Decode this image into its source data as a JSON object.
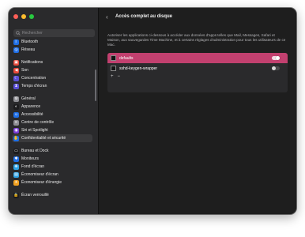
{
  "window": {
    "traffic_colors": [
      "#ff5f57",
      "#febc2e",
      "#28c840"
    ]
  },
  "sidebar": {
    "search_placeholder": "Rechercher",
    "items": [
      {
        "label": "Bluetooth",
        "icon": "bluetooth-icon",
        "color": "#1f6fe6",
        "glyph": "ᛒ"
      },
      {
        "label": "Réseau",
        "icon": "network-icon",
        "color": "#1f6fe6",
        "glyph": "◎"
      },
      {
        "label": "Notifications",
        "icon": "notifications-icon",
        "color": "#e84a3b",
        "glyph": "▣"
      },
      {
        "label": "Son",
        "icon": "sound-icon",
        "color": "#e84a3b",
        "glyph": "◀"
      },
      {
        "label": "Concentration",
        "icon": "focus-icon",
        "color": "#5b4fd6",
        "glyph": "☾"
      },
      {
        "label": "Temps d'écran",
        "icon": "screen-time-icon",
        "color": "#5b4fd6",
        "glyph": "⧗"
      },
      {
        "label": "Général",
        "icon": "general-icon",
        "color": "#8e8e93",
        "glyph": "⚙"
      },
      {
        "label": "Apparence",
        "icon": "appearance-icon",
        "color": "#1c1c1e",
        "glyph": "◐"
      },
      {
        "label": "Accessibilité",
        "icon": "accessibility-icon",
        "color": "#1f6fe6",
        "glyph": "☺"
      },
      {
        "label": "Centre de contrôle",
        "icon": "control-center-icon",
        "color": "#8e8e93",
        "glyph": "≡"
      },
      {
        "label": "Siri et Spotlight",
        "icon": "siri-icon",
        "color": "#7b3fd6",
        "glyph": "◉"
      },
      {
        "label": "Confidentialité et sécurité",
        "icon": "privacy-hand-icon",
        "color": "#1f6fe6",
        "glyph": "✋"
      },
      {
        "label": "Bureau et Dock",
        "icon": "desktop-dock-icon",
        "color": "#1c1c1e",
        "glyph": "▭"
      },
      {
        "label": "Moniteurs",
        "icon": "displays-icon",
        "color": "#1f6fe6",
        "glyph": "✱"
      },
      {
        "label": "Fond d'écran",
        "icon": "wallpaper-icon",
        "color": "#2fa3e6",
        "glyph": "❋"
      },
      {
        "label": "Économiseur d'écran",
        "icon": "screen-saver-icon",
        "color": "#2fa3e6",
        "glyph": "▤"
      },
      {
        "label": "Économiseur d'énergie",
        "icon": "energy-saver-icon",
        "color": "#f0a020",
        "glyph": "☀"
      },
      {
        "label": "Écran verrouillé",
        "icon": "lock-screen-icon",
        "color": "#1c1c1e",
        "glyph": "🔒"
      }
    ],
    "active_index": 11
  },
  "main": {
    "title": "Accès complet au disque",
    "description": "Autoriser les applications ci-dessous à accéder aux données d'apps telles que Mail, Messages, Safari et Maison, aux sauvegardes Time Machine, et à certains réglages d'administration pour tous les utilisateurs de ce Mac.",
    "apps": [
      {
        "name": "defaults",
        "enabled": true,
        "selected": true
      },
      {
        "name": "sshd-keygen-wrapper",
        "enabled": false,
        "selected": false
      }
    ],
    "add_label": "+",
    "remove_label": "−"
  }
}
